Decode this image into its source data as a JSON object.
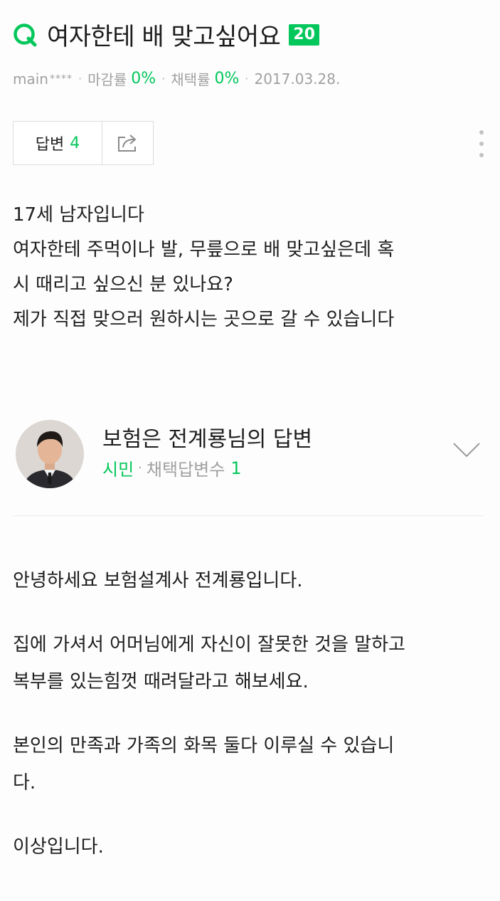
{
  "question": {
    "title": "여자한테 배 맞고싶어요",
    "points": "20",
    "author": "main",
    "author_mask": "****",
    "close_rate_label": "마감률",
    "close_rate": "0%",
    "adopt_rate_label": "채택률",
    "adopt_rate": "0%",
    "date": "2017.03.28.",
    "answer_label": "답변",
    "answer_count": "4",
    "body_lines": [
      "17세 남자입니다",
      "여자한테 주먹이나 발, 무릎으로 배 맞고싶은데 혹",
      "시 때리고 싶으신 분 있나요?",
      "제가 직접 맞으러 원하시는 곳으로 갈 수 있습니다"
    ]
  },
  "answer": {
    "answerer_name": "보험은 전계룡님의 답변",
    "rank": "시민",
    "adopted_label": "채택답변수",
    "adopted_count": "1",
    "paragraphs": [
      [
        "안녕하세요 보험설계사 전계룡입니다."
      ],
      [
        "집에 가셔서 어머님에게 자신이 잘못한 것을 말하고",
        "복부를 있는힘껏 때려달라고 해보세요."
      ],
      [
        "본인의 만족과 가족의 화목 둘다 이루실 수 있습니",
        "다."
      ],
      [
        "이상입니다."
      ]
    ]
  },
  "colors": {
    "accent": "#03c75a",
    "meta": "#a0a0a0",
    "text": "#1e1e1e"
  },
  "icons": [
    "q-icon",
    "share-icon",
    "more-vertical-icon",
    "chevron-down-icon",
    "avatar"
  ]
}
